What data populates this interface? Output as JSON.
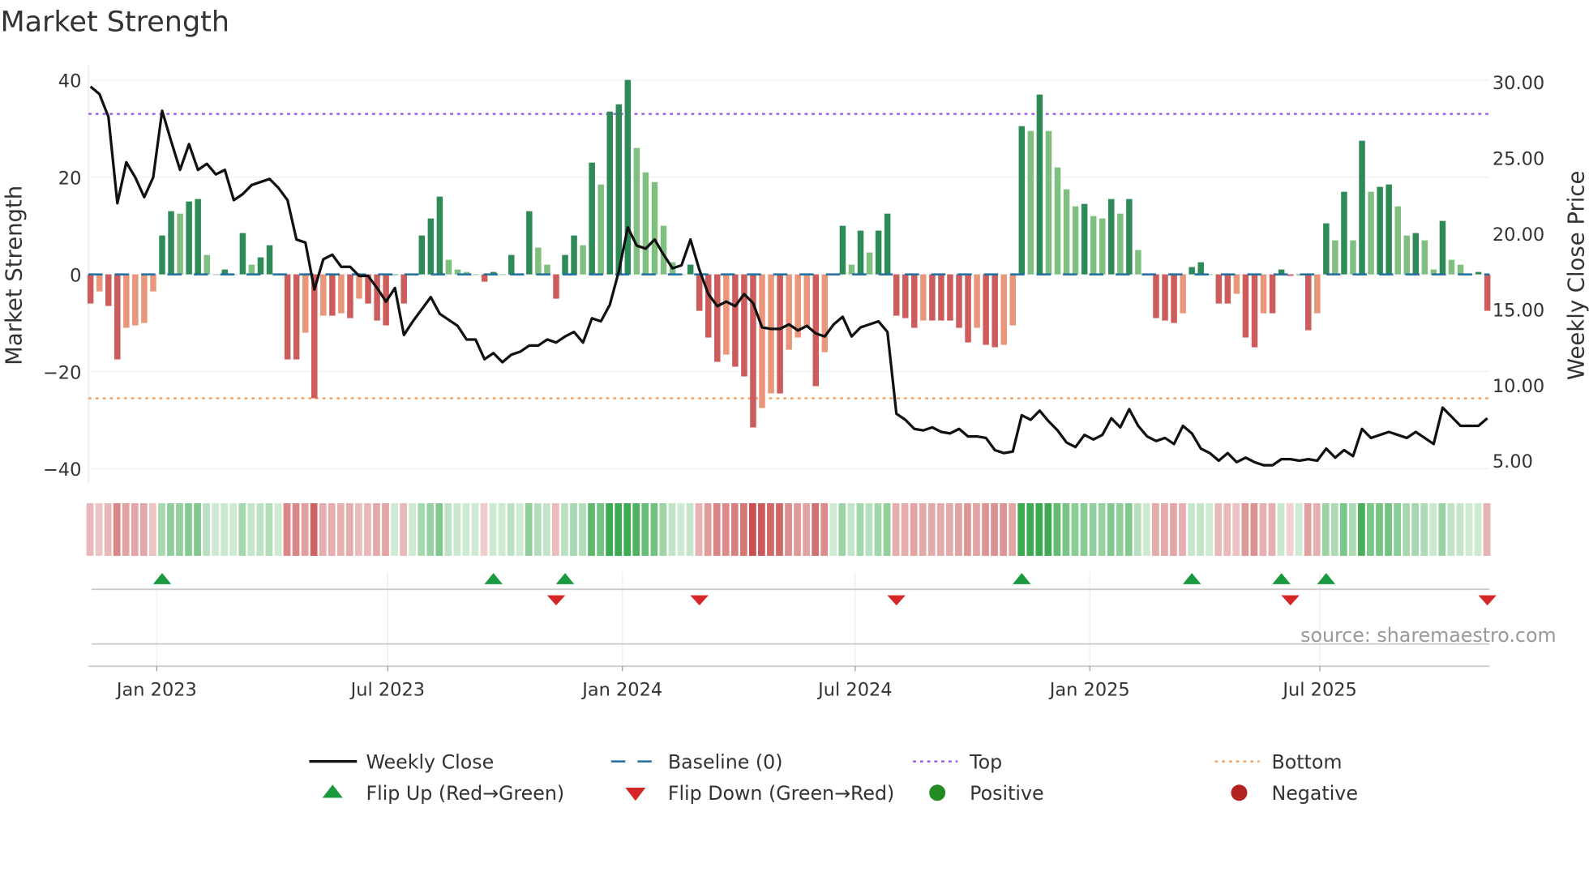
{
  "chart_data": {
    "type": "bar+line",
    "title": "Market Strength",
    "ylabel": "Market Strength",
    "y2label": "Weekly Close Price",
    "ylim": [
      -43,
      42
    ],
    "y2lim": [
      4.3,
      31.1
    ],
    "yticks": [
      "40",
      "20",
      "0",
      "−20",
      "−40"
    ],
    "ytick_values": [
      40,
      20,
      0,
      -20,
      -40
    ],
    "y2ticks": [
      "30.00",
      "25.00",
      "20.00",
      "15.00",
      "10.00",
      "5.00"
    ],
    "y2tick_values": [
      30,
      25,
      20,
      15,
      10,
      5
    ],
    "xticks": [
      "Jan 2023",
      "Jul 2023",
      "Jan 2024",
      "Jul 2024",
      "Jan 2025",
      "Jul 2025"
    ],
    "xtick_week_index": [
      7.4,
      33.2,
      59.4,
      85.4,
      111.6,
      137.3
    ],
    "top_level": 33,
    "bottom_level": -25.5,
    "baseline": 0,
    "strength": [
      -6,
      -3.5,
      -6.5,
      -17.5,
      -11,
      -10.5,
      -10,
      -3.5,
      8,
      13,
      12.5,
      15,
      15.5,
      4,
      0,
      1,
      0,
      8.5,
      2,
      3.5,
      6,
      0,
      -17.5,
      -17.5,
      -12,
      -25.5,
      -8.5,
      -8.5,
      -8,
      -9,
      -5,
      -6,
      -9.5,
      -10.5,
      0,
      -6,
      0,
      8,
      11.5,
      16,
      3,
      1,
      0.5,
      0,
      -1.5,
      0.5,
      0,
      4,
      0,
      13,
      5.5,
      2,
      -5,
      4,
      8,
      6,
      23,
      18.5,
      33.5,
      35,
      40,
      26,
      21,
      19,
      10,
      2.5,
      0,
      2,
      -7.5,
      -13,
      -18,
      -16.5,
      -19,
      -21,
      -31.5,
      -27.5,
      -24.5,
      -24.5,
      -15.5,
      -13,
      -11,
      -23,
      -16,
      0,
      10,
      2,
      9,
      4.5,
      9,
      12.5,
      -8.5,
      -9,
      -11,
      -9.5,
      -9.5,
      -9.5,
      -9.5,
      -11,
      -14,
      -11,
      -14.5,
      -15,
      -14.5,
      -10.5,
      30.5,
      29.5,
      37,
      29.5,
      22,
      17.5,
      14,
      14.5,
      12,
      11.5,
      15.5,
      12.5,
      15.5,
      5,
      0,
      -9,
      -9.5,
      -10,
      -8,
      1.5,
      2.5,
      0,
      -6,
      -6,
      -4,
      -13,
      -15,
      -8,
      -8,
      1,
      -0.3,
      0,
      -11.5,
      -8,
      10.5,
      7,
      17,
      7,
      27.5,
      17,
      18,
      18.5,
      14,
      8,
      8.5,
      7,
      1,
      11,
      3,
      2,
      0,
      0.5,
      -7.5
    ],
    "weekly_close": [
      29.7,
      29.2,
      27.7,
      22.0,
      24.7,
      23.7,
      22.4,
      23.7,
      28.1,
      26.1,
      24.2,
      25.9,
      24.2,
      24.6,
      23.9,
      24.2,
      22.2,
      22.6,
      23.2,
      23.4,
      23.6,
      23.0,
      22.2,
      19.6,
      19.4,
      16.3,
      18.3,
      18.6,
      17.8,
      17.8,
      17.2,
      17.2,
      16.4,
      15.5,
      16.4,
      13.3,
      14.2,
      15.0,
      15.8,
      14.7,
      14.3,
      13.9,
      13.0,
      13.0,
      11.7,
      12.1,
      11.5,
      12.0,
      12.2,
      12.6,
      12.6,
      13.0,
      12.8,
      13.2,
      13.5,
      12.8,
      14.4,
      14.2,
      15.3,
      17.5,
      20.4,
      19.2,
      19.0,
      19.6,
      18.6,
      17.7,
      17.9,
      19.6,
      17.6,
      16.0,
      15.2,
      15.5,
      15.2,
      16.0,
      15.4,
      13.8,
      13.7,
      13.7,
      14.0,
      13.6,
      13.9,
      13.4,
      13.2,
      14.0,
      14.5,
      13.2,
      13.8,
      14.0,
      14.2,
      13.5,
      8.1,
      7.7,
      7.1,
      7.0,
      7.2,
      6.9,
      6.8,
      7.1,
      6.6,
      6.6,
      6.5,
      5.7,
      5.5,
      5.6,
      8.0,
      7.7,
      8.3,
      7.6,
      7.0,
      6.2,
      5.9,
      6.7,
      6.4,
      6.7,
      7.8,
      7.2,
      8.4,
      7.3,
      6.6,
      6.3,
      6.5,
      6.1,
      7.3,
      6.8,
      5.8,
      5.5,
      5.0,
      5.5,
      4.9,
      5.2,
      4.9,
      4.7,
      4.7,
      5.1,
      5.1,
      5.0,
      5.1,
      5.0,
      5.8,
      5.2,
      5.7,
      5.3,
      7.1,
      6.5,
      6.7,
      6.9,
      6.7,
      6.5,
      6.9,
      6.5,
      6.1,
      8.5,
      7.9,
      7.3,
      7.3,
      7.3,
      7.8
    ],
    "colors": {
      "strong_green": "#2e8b57",
      "light_green": "#7fbf7f",
      "strong_red": "#cd5c5c",
      "light_red": "#e9967a",
      "line": "#111111",
      "baseline": "#1f6f9f",
      "top": "#9b5de5",
      "bottom": "#f4a261",
      "flip_up": "#1a9a3f",
      "flip_down": "#d62728",
      "positive": "#228b22",
      "negative": "#b22222"
    },
    "legend": {
      "placement": "bottom-center",
      "entries": [
        "Weekly Close",
        "Baseline (0)",
        "Top",
        "Bottom",
        "Flip Up (Red→Green)",
        "Flip Down (Green→Red)",
        "Positive",
        "Negative"
      ]
    },
    "source": "source: sharemaestro.com"
  }
}
